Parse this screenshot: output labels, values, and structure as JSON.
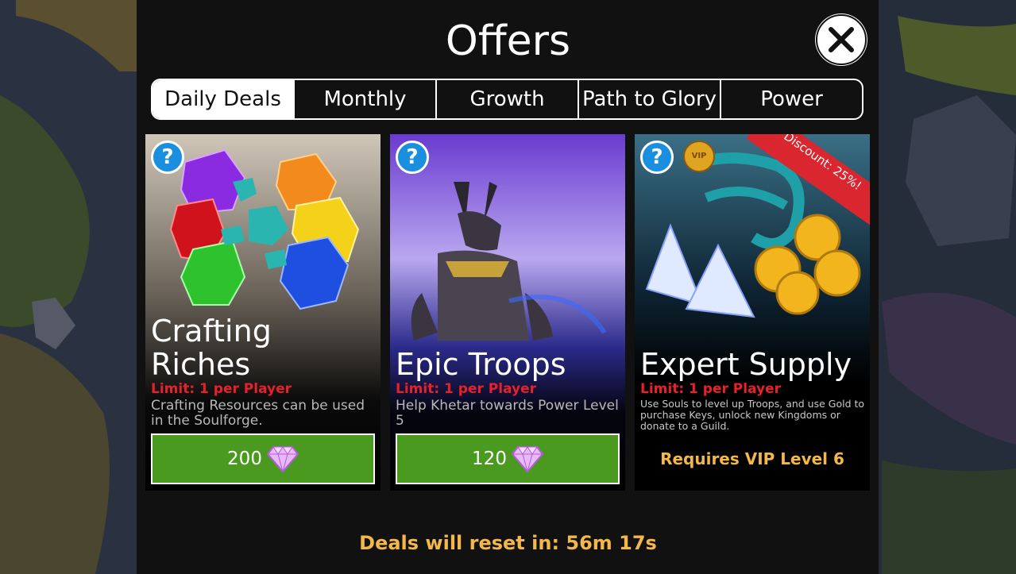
{
  "title": "Offers",
  "tabs": [
    {
      "label": "Daily Deals",
      "active": true
    },
    {
      "label": "Monthly",
      "active": false
    },
    {
      "label": "Growth",
      "active": false
    },
    {
      "label": "Path to Glory",
      "active": false
    },
    {
      "label": "Power",
      "active": false
    }
  ],
  "offers": [
    {
      "name_line1": "Crafting",
      "name_line2": "Riches",
      "limit": "Limit: 1 per Player",
      "description": "Crafting Resources can be used in the Soulforge.",
      "price": "200",
      "price_icon": "gem-icon"
    },
    {
      "name_line1": "Epic Troops",
      "limit": "Limit: 1 per Player",
      "description": "Help Khetar towards Power Level 5",
      "price": "120",
      "price_icon": "gem-icon"
    },
    {
      "name_line1": "Expert Supply",
      "limit": "Limit: 1 per Player",
      "description": "Use Souls to level up Troops, and use Gold to purchase Keys, unlock new Kingdoms or donate to a Guild.",
      "badge": "Discount: 25%!",
      "vip_icon": "VIP",
      "requirement": "Requires VIP Level 6"
    }
  ],
  "help_icon": "?",
  "reset_text": "Deals will reset in: 56m 17s",
  "colors": {
    "limit": "#e8202a",
    "buy_button": "#4a9a1f",
    "vip_text": "#f3b74a",
    "help_icon": "#1a8fe0"
  }
}
